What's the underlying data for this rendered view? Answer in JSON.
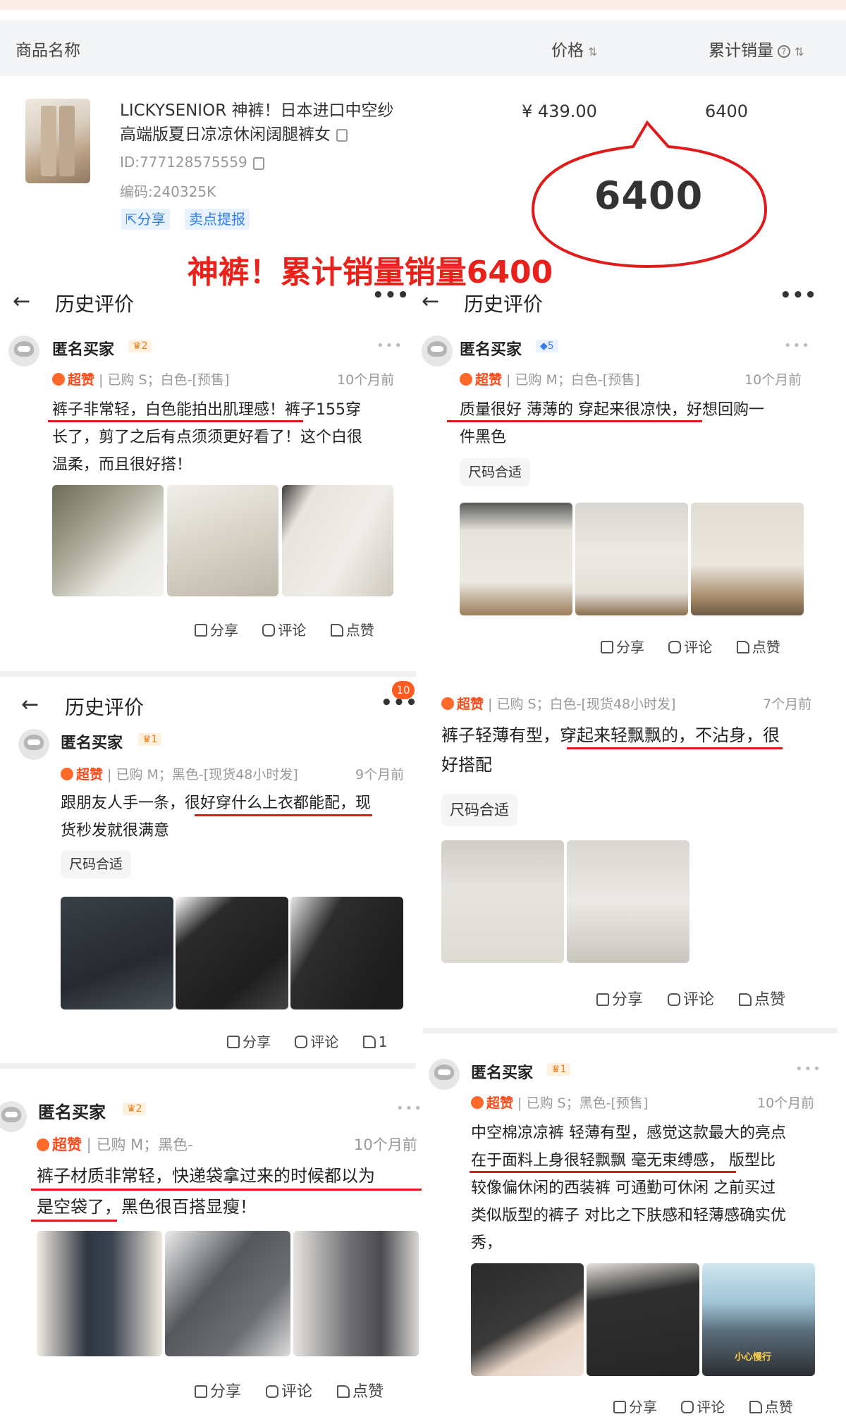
{
  "product_header": {
    "col_name": "商品名称",
    "col_price": "价格",
    "col_sales": "累计销量",
    "title_line1": "LICKYSENIOR 神裤！日本进口中空纱",
    "title_line2": "高端版夏日凉凉休闲阔腿裤女",
    "id": "ID:777128575559",
    "code": "编码:240325K",
    "share": "分享",
    "sell_point": "卖点提报",
    "price": "¥ 439.00",
    "sales": "6400",
    "bubble_value": "6400"
  },
  "headline": "神裤！累计销量销量6400",
  "panel_title": "历史评价",
  "actions": {
    "share": "分享",
    "comment": "评论",
    "like": "点赞"
  },
  "fit_tag": "尺码合适",
  "reviews": [
    {
      "user": "匿名买家",
      "level": "2",
      "zan": "超赞",
      "meta": "已购 S；白色-[预售]",
      "time": "10个月前",
      "lines": [
        "裤子非常轻，白色能拍出肌理感！裤子155穿",
        "长了，剪了之后有点须须更好看了！这个白很",
        "温柔，而且很好搭！"
      ]
    },
    {
      "user": "匿名买家",
      "level": "5",
      "zan": "超赞",
      "meta": "已购 M；白色-[预售]",
      "time": "10个月前",
      "lines": [
        "质量很好 薄薄的 穿起来很凉快，好想回购一",
        "件黑色"
      ]
    },
    {
      "user": "匿名买家",
      "level": "1",
      "zan": "超赞",
      "meta": "已购 M；黑色-[现货48小时发]",
      "time": "9个月前",
      "lines": [
        "跟朋友人手一条，很好穿什么上衣都能配，现",
        "货秒发就很满意"
      ],
      "like_count": "1",
      "badge": "10"
    },
    {
      "zan": "超赞",
      "meta": "已购 S；白色-[现货48小时发]",
      "time": "7个月前",
      "lines": [
        "裤子轻薄有型，穿起来轻飘飘的，不沾身，很",
        "好搭配"
      ]
    },
    {
      "user": "匿名买家",
      "level": "2",
      "zan": "超赞",
      "meta": "已购 M；黑色-",
      "time": "10个月前",
      "lines": [
        "裤子材质非常轻，快递袋拿过来的时候都以为",
        "是空袋了，黑色很百搭显瘦！"
      ]
    },
    {
      "user": "匿名买家",
      "level": "1",
      "zan": "超赞",
      "meta": "已购 S；黑色-[预售]",
      "time": "10个月前",
      "lines": [
        "中空棉凉凉裤 轻薄有型，感觉这款最大的亮点",
        "在于面料上身很轻飘飘 毫无束缚感， 版型比",
        "较像偏休闲的西装裤 可通勤可休闲 之前买过",
        "类似版型的裤子 对比之下肤感和轻薄感确实优",
        "秀，"
      ],
      "sign_text": "小心慢行"
    }
  ],
  "colors": {
    "accent_red": "#e8221b",
    "zan_orange": "#ff4a1a",
    "link_blue": "#2f7cf6"
  }
}
